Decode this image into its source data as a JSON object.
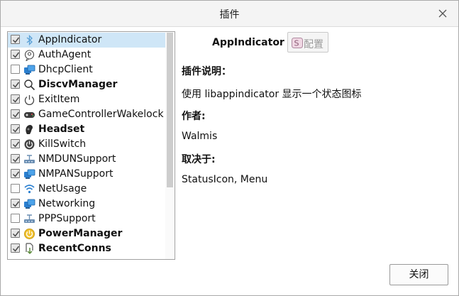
{
  "window": {
    "title": "插件"
  },
  "plugins": [
    {
      "name": "AppIndicator",
      "checked": true,
      "bold": false,
      "selected": true,
      "icon": "bluetooth-icon"
    },
    {
      "name": "AuthAgent",
      "checked": true,
      "bold": false,
      "selected": false,
      "icon": "chat-bubble-icon"
    },
    {
      "name": "DhcpClient",
      "checked": false,
      "bold": false,
      "selected": false,
      "icon": "network-computers-icon"
    },
    {
      "name": "DiscvManager",
      "checked": true,
      "bold": true,
      "selected": false,
      "icon": "magnifier-icon"
    },
    {
      "name": "ExitItem",
      "checked": true,
      "bold": false,
      "selected": false,
      "icon": "power-icon"
    },
    {
      "name": "GameControllerWakelock",
      "checked": true,
      "bold": false,
      "selected": false,
      "icon": "gamepad-icon"
    },
    {
      "name": "Headset",
      "checked": true,
      "bold": true,
      "selected": false,
      "icon": "headset-icon"
    },
    {
      "name": "KillSwitch",
      "checked": true,
      "bold": false,
      "selected": false,
      "icon": "kill-switch-icon"
    },
    {
      "name": "NMDUNSupport",
      "checked": true,
      "bold": false,
      "selected": false,
      "icon": "network-hub-icon"
    },
    {
      "name": "NMPANSupport",
      "checked": true,
      "bold": false,
      "selected": false,
      "icon": "network-computers-icon"
    },
    {
      "name": "NetUsage",
      "checked": false,
      "bold": false,
      "selected": false,
      "icon": "wifi-icon"
    },
    {
      "name": "Networking",
      "checked": true,
      "bold": false,
      "selected": false,
      "icon": "network-computers-icon"
    },
    {
      "name": "PPPSupport",
      "checked": false,
      "bold": false,
      "selected": false,
      "icon": "network-hub-icon"
    },
    {
      "name": "PowerManager",
      "checked": true,
      "bold": true,
      "selected": false,
      "icon": "power-manager-icon"
    },
    {
      "name": "RecentConns",
      "checked": true,
      "bold": true,
      "selected": false,
      "icon": "recent-connections-icon"
    }
  ],
  "details": {
    "plugin_name": "AppIndicator",
    "config_label": "配置",
    "description_heading": "插件说明：",
    "description": "使用 libappindicator 显示一个状态图标",
    "author_heading": "作者:",
    "author": "Walmis",
    "depends_heading": "取决于:",
    "depends": "StatusIcon, Menu"
  },
  "buttons": {
    "close_label": "关闭"
  }
}
